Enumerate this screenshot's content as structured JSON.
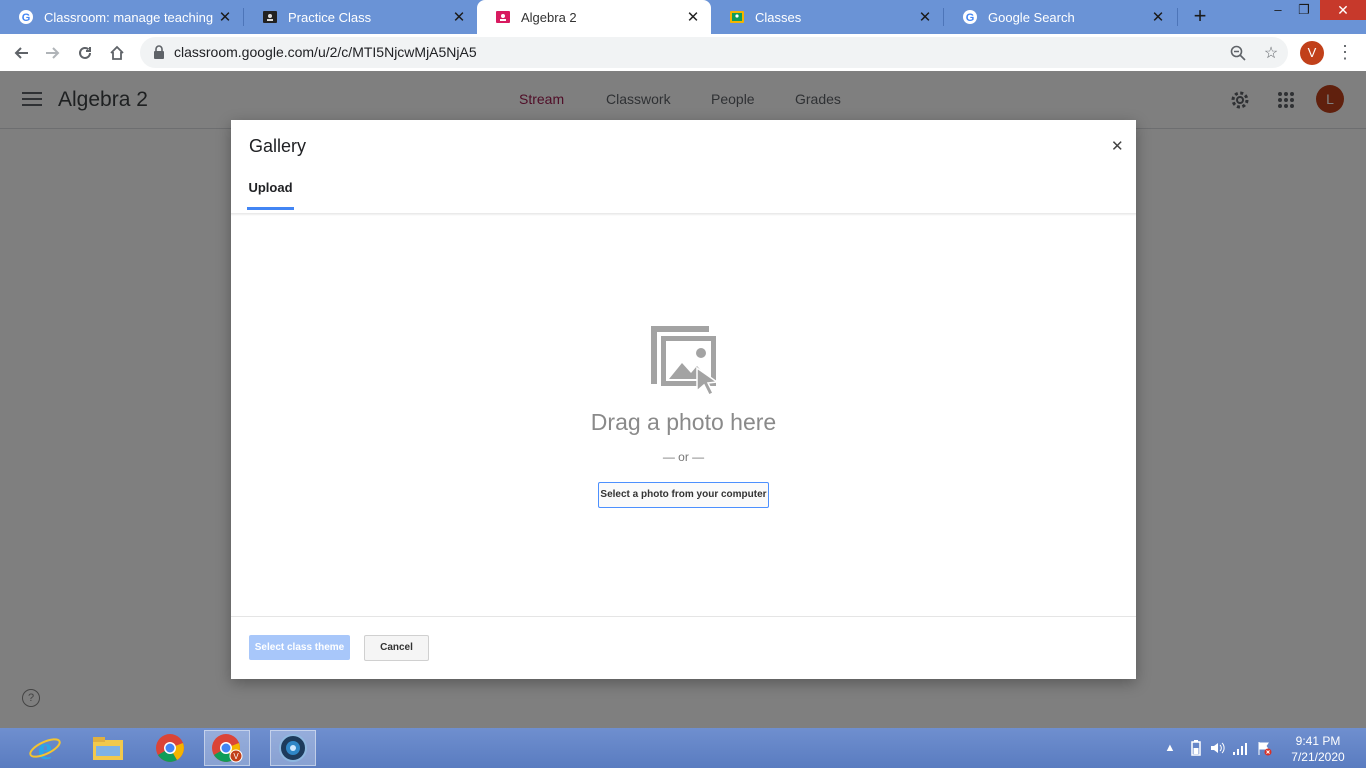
{
  "browser": {
    "tabs": [
      {
        "title": "Classroom: manage teaching an",
        "icon": "google-g-icon"
      },
      {
        "title": "Practice Class",
        "icon": "classroom-icon"
      },
      {
        "title": "Algebra 2",
        "icon": "classroom-icon",
        "active": true
      },
      {
        "title": "Classes",
        "icon": "classroom-icon"
      },
      {
        "title": "Google Search",
        "icon": "google-g-icon"
      }
    ],
    "url": "classroom.google.com/u/2/c/MTI5NjcwMjA5NjA5",
    "profile_initial": "V"
  },
  "app": {
    "title": "Algebra 2",
    "nav": [
      "Stream",
      "Classwork",
      "People",
      "Grades"
    ],
    "active_nav": "Stream",
    "avatar_initial": "L",
    "help_label": "?"
  },
  "dialog": {
    "title": "Gallery",
    "tab": "Upload",
    "drag_text": "Drag a photo here",
    "or_text": "— or —",
    "select_button": "Select a photo from your computer",
    "primary_button": "Select class theme",
    "cancel_button": "Cancel"
  },
  "taskbar": {
    "time": "9:41 PM",
    "date": "7/21/2020",
    "chrome_badge": "V"
  },
  "colors": {
    "tab_strip": "#6a93d6",
    "accent_stream": "#a01d50",
    "avatar": "#c1401a",
    "primary_disabled": "#a8c7fa"
  }
}
